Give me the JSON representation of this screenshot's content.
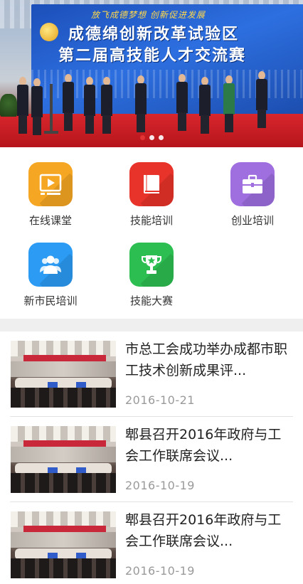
{
  "banner": {
    "slogan": "放飞成德梦想 创新促进发展",
    "title_line1": "成德绵创新改革试验区",
    "title_line2": "第二届高技能人才交流赛",
    "slide_count": 3,
    "active_slide": 1
  },
  "features": [
    {
      "label": "在线课堂",
      "icon": "video-play-icon",
      "color": "#F5A623"
    },
    {
      "label": "技能培训",
      "icon": "book-icon",
      "color": "#E8332A"
    },
    {
      "label": "创业培训",
      "icon": "briefcase-icon",
      "color": "#9F6FE0"
    },
    {
      "label": "新市民培训",
      "icon": "people-group-icon",
      "color": "#2B9BF4"
    },
    {
      "label": "技能大赛",
      "icon": "trophy-icon",
      "color": "#2DBE52"
    }
  ],
  "news": [
    {
      "title": "市总工会成功举办成都市职工技术创新成果评...",
      "date": "2016-10-21"
    },
    {
      "title": "郫县召开2016年政府与工会工作联席会议...",
      "date": "2016-10-19"
    },
    {
      "title": "郫县召开2016年政府与工会工作联席会议...",
      "date": "2016-10-19"
    }
  ]
}
